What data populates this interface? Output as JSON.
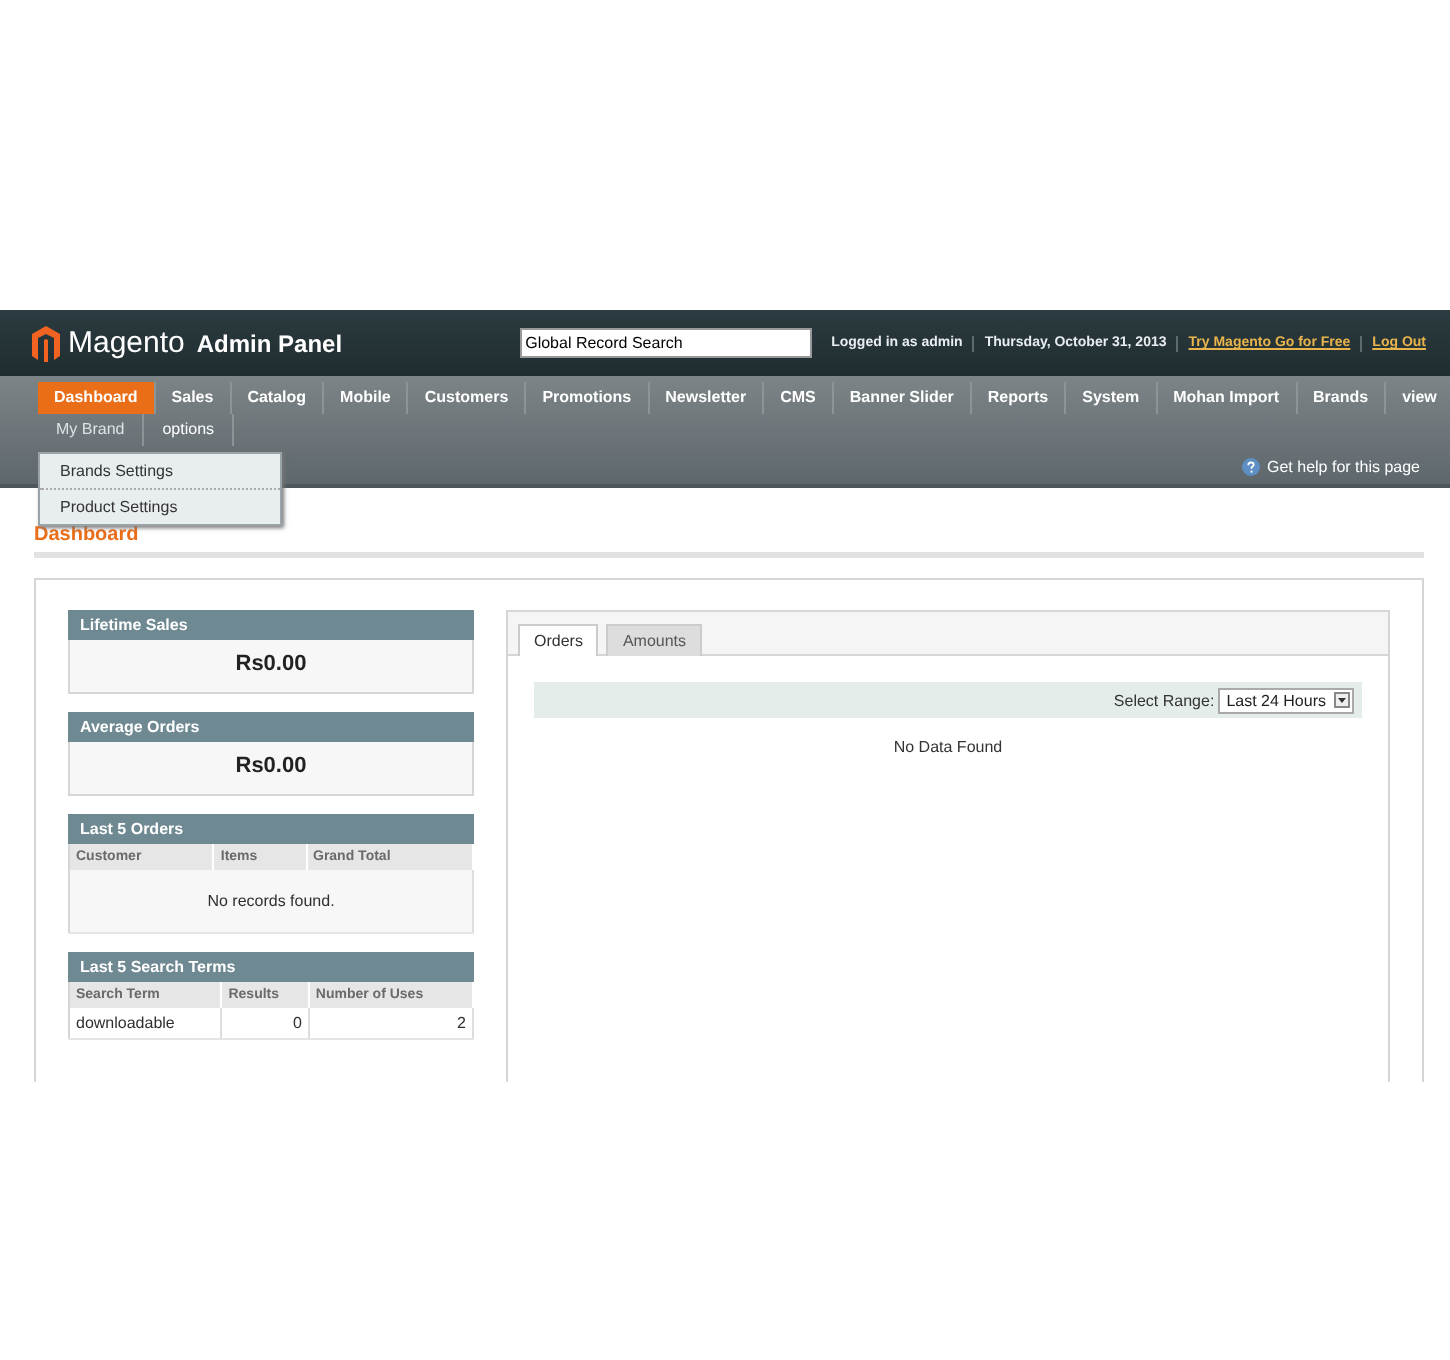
{
  "header": {
    "logo": "Magento",
    "logo_suffix": "Admin Panel",
    "search": {
      "value": "Global Record Search"
    },
    "links": [
      {
        "text": "Logged in as admin",
        "kind": "text"
      },
      {
        "text": "Thursday, October 31, 2013",
        "kind": "text"
      },
      {
        "text": "Try Magento Go for Free",
        "kind": "promo"
      },
      {
        "text": "Log Out",
        "kind": "link"
      }
    ]
  },
  "menu": [
    {
      "label": "Dashboard",
      "selected": true
    },
    {
      "label": "Sales",
      "selected": false
    },
    {
      "label": "Catalog",
      "selected": false
    },
    {
      "label": "Mobile",
      "selected": false
    },
    {
      "label": "Customers",
      "selected": false
    },
    {
      "label": "Promotions",
      "selected": false
    },
    {
      "label": "Newsletter",
      "selected": false
    },
    {
      "label": "CMS",
      "selected": false
    },
    {
      "label": "Banner Slider",
      "selected": false
    },
    {
      "label": "Reports",
      "selected": false
    },
    {
      "label": "System",
      "selected": false
    },
    {
      "label": "Mohan Import",
      "selected": false
    },
    {
      "label": "Brands",
      "selected": false
    },
    {
      "label": "view",
      "selected": false
    }
  ],
  "menu_row2": [
    {
      "label": "My Brand",
      "expanded": true
    },
    {
      "label": "options",
      "expanded": false
    }
  ],
  "dropdown": [
    "Brands Settings",
    "Product Settings"
  ],
  "help": "Get help for this page",
  "page_title": "Dashboard",
  "stats": [
    {
      "title": "Lifetime Sales",
      "value": "Rs0.00"
    },
    {
      "title": "Average Orders",
      "value": "Rs0.00"
    }
  ],
  "last_orders": {
    "title": "Last 5 Orders",
    "columns": [
      "Customer",
      "Items",
      "Grand Total"
    ],
    "empty": "No records found."
  },
  "search_terms": {
    "title": "Last 5 Search Terms",
    "columns": [
      "Search Term",
      "Results",
      "Number of Uses"
    ],
    "rows": [
      [
        "downloadable",
        "0",
        "2"
      ]
    ]
  },
  "tabs": [
    {
      "label": "Orders",
      "selected": true
    },
    {
      "label": "Amounts",
      "selected": false
    }
  ],
  "range": {
    "label": "Select Range:",
    "value": "Last 24 Hours"
  },
  "chart_message": "No Data Found"
}
